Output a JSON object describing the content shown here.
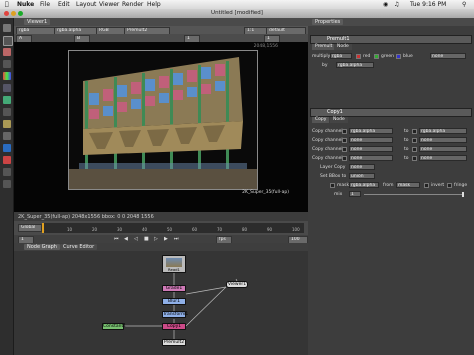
{
  "menubar": {
    "app": "Nuke",
    "items": [
      "File",
      "Edit",
      "Layout",
      "Viewer",
      "Render",
      "Help"
    ],
    "clock": "Tue 9:16 PM"
  },
  "window": {
    "title": "Untitled [modified]"
  },
  "viewer": {
    "tab": "Viewer1",
    "channel_set": "rgba",
    "alpha_channel": "rgba.alpha",
    "colorspace": "RGB",
    "input": "Premult2",
    "zoom": "1:1",
    "lut": "default",
    "format_label": "2048,1556",
    "image_label": "2K_Super_35(full-ap)",
    "info": "2K_Super_35(full-ap) 2048x1556  bbox: 0 0 2048 1556",
    "channel_a": "A",
    "channel_b": "B",
    "exposure": "1",
    "gain": "1"
  },
  "timeline": {
    "global_label": "Global",
    "ticks": [
      "1",
      "10",
      "20",
      "30",
      "40",
      "50",
      "60",
      "70",
      "80",
      "90",
      "100"
    ],
    "fps": "fps",
    "frame": "1",
    "end_frame": "100"
  },
  "nodegraph": {
    "tabs": [
      "Node Graph",
      "Curve Editor"
    ],
    "nodes": {
      "read": "Read1",
      "grade": "Grade1",
      "blur": "Blur1",
      "transform": "Transform1",
      "copy": "Copy1",
      "premult": "Premult2",
      "constant": "Constant1",
      "viewer": "Viewer1"
    }
  },
  "properties": {
    "title": "Properties",
    "premult": {
      "name": "Premult1",
      "tabs": [
        "Premult",
        "Node"
      ],
      "multiply_label": "multiply",
      "multiply_value": "rgba",
      "ch_red": "red",
      "ch_green": "green",
      "ch_blue": "blue",
      "ch_none": "none",
      "by_label": "by",
      "by_value": "rgba.alpha"
    },
    "copy": {
      "name": "Copy1",
      "tabs": [
        "Copy",
        "Node"
      ],
      "rows": [
        {
          "label": "Copy channel",
          "from": "rgba.alpha",
          "to_label": "to",
          "to": "rgba.alpha"
        },
        {
          "label": "Copy channel",
          "from": "none",
          "to_label": "to",
          "to": "none"
        },
        {
          "label": "Copy channel",
          "from": "none",
          "to_label": "to",
          "to": "none"
        },
        {
          "label": "Copy channel",
          "from": "none",
          "to_label": "to",
          "to": "none"
        }
      ],
      "layer_copy_label": "Layer Copy",
      "layer_copy_value": "none",
      "set_bbox_label": "Set BBox to",
      "set_bbox_value": "union",
      "mask_label": "mask",
      "mask_value": "rgba.alpha",
      "from_label": "from",
      "from_value": "mask",
      "invert_label": "invert",
      "fringe_label": "fringe",
      "mix_label": "mix",
      "mix_value": "1"
    }
  },
  "colors": {
    "node_read": "#bbbbbb",
    "node_grade": "#d07ab8",
    "node_blur": "#8fb0e8",
    "node_copy": "#cc4a88",
    "node_constant": "#78c070",
    "node_viewer": "#dddddd",
    "accent": "#e0a020"
  }
}
